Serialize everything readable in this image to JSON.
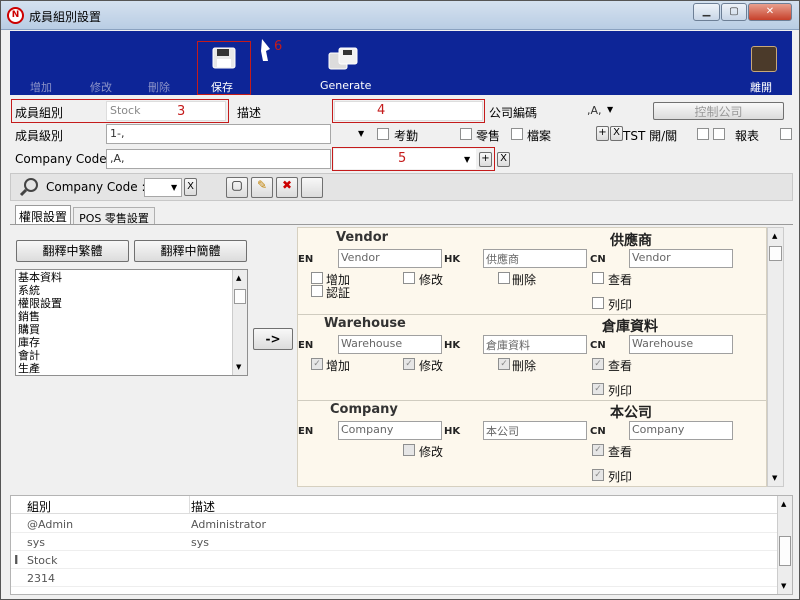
{
  "window": {
    "title": "成員組別設置",
    "min_glyph": "▁",
    "max_glyph": "▢",
    "close_glyph": "✕",
    "app_icon": "N"
  },
  "toolbar": {
    "add_label": "增加",
    "edit_label": "修改",
    "delete_label": "刪除",
    "save_label": "保存",
    "generate_label": "Generate",
    "exit_label": "離開",
    "annotation_save": "6"
  },
  "form": {
    "group_label": "成員組別",
    "group_value": "Stock",
    "annotation_group": "3",
    "desc_label": "描述",
    "desc_value": "",
    "annotation_desc": "4",
    "company_no_label": "公司編碼",
    "company_no_value": ",A,",
    "control_company_label": "控制公司",
    "level_label": "成員級別",
    "level_value": "1-,",
    "attendance_label": "考勤",
    "retail_label": "零售",
    "file_label": "檔案",
    "tst_label": "TST 開/關",
    "report_label": "報表",
    "company_code_label": "Company Code :",
    "company_code_value": ",A,",
    "annotation_company": "5"
  },
  "subtool": {
    "company_code_label": "Company Code :",
    "x_label": "X"
  },
  "tabs": [
    {
      "label": "權限設置"
    },
    {
      "label": "POS 零售設置"
    }
  ],
  "translate": {
    "trad_label": "翻釋中繁體",
    "simp_label": "翻釋中簡體",
    "arrow_label": "->"
  },
  "module_list": [
    "基本資料",
    "系統",
    "權限設置",
    "銷售",
    "購買",
    "庫存",
    "會計",
    "生產"
  ],
  "permissions": {
    "en_tag": "EN",
    "hk_tag": "HK",
    "cn_tag": "CN",
    "sections": [
      {
        "en_title": "Vendor",
        "cn_title": "供應商",
        "en_value": "Vendor",
        "hk_value": "供應商",
        "cn_value": "Vendor",
        "add": "增加",
        "edit": "修改",
        "del": "刪除",
        "view": "查看",
        "print": "列印",
        "approve": "認証"
      },
      {
        "en_title": "Warehouse",
        "cn_title": "倉庫資料",
        "en_value": "Warehouse",
        "hk_value": "倉庫資料",
        "cn_value": "Warehouse",
        "add": "增加",
        "edit": "修改",
        "del": "刪除",
        "view": "查看",
        "print": "列印"
      },
      {
        "en_title": "Company",
        "cn_title": "本公司",
        "en_value": "Company",
        "hk_value": "本公司",
        "cn_value": "Company",
        "edit": "修改",
        "view": "查看",
        "print": "列印"
      }
    ]
  },
  "grid": {
    "headers": [
      "組別",
      "描述"
    ],
    "rows": [
      {
        "group": "@Admin",
        "desc": "Administrator"
      },
      {
        "group": "sys",
        "desc": "sys"
      },
      {
        "group": "Stock",
        "desc": ""
      },
      {
        "group": "2314",
        "desc": ""
      }
    ]
  },
  "colors": {
    "toolbar_bg": "#0d2597",
    "annotation": "#c41b1b",
    "panel_bg": "#fdf8ed"
  }
}
